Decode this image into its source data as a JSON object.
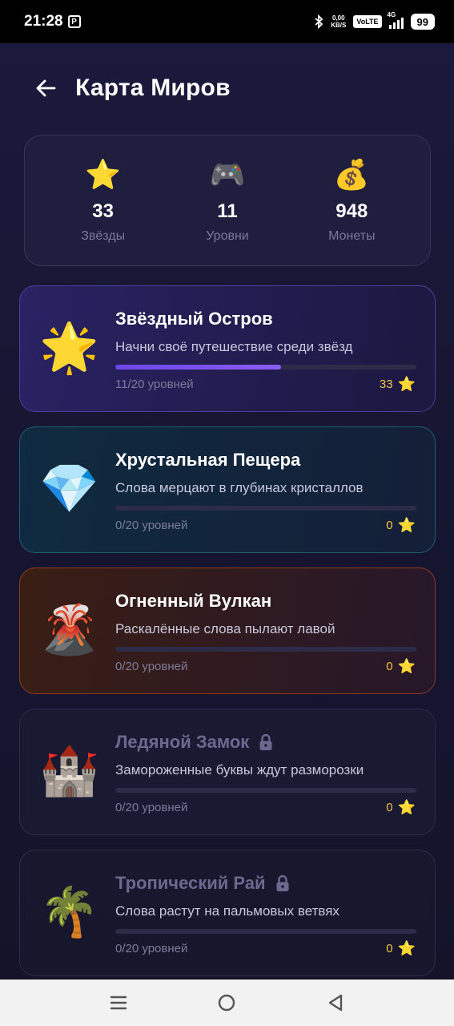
{
  "status_bar": {
    "time": "21:28",
    "net_speed_value": "0,00",
    "net_speed_unit": "KB/S",
    "volte": "VoLTE",
    "network": "4G",
    "battery": "99"
  },
  "header": {
    "title": "Карта Миров"
  },
  "stats": [
    {
      "icon": "⭐",
      "icon_name": "star-icon",
      "value": "33",
      "label": "Звёзды"
    },
    {
      "icon": "🎮",
      "icon_name": "gamepad-icon",
      "value": "11",
      "label": "Уровни"
    },
    {
      "icon": "💰",
      "icon_name": "money-bag-icon",
      "value": "948",
      "label": "Монеты"
    }
  ],
  "worlds": [
    {
      "icon": "🌟",
      "icon_name": "glowing-star-icon",
      "title": "Звёздный Остров",
      "description": "Начни своё путешествие среди звёзд",
      "levels_text": "11/20 уровней",
      "progress": 0.55,
      "stars": "33",
      "locked": false
    },
    {
      "icon": "💎",
      "icon_name": "gem-icon",
      "title": "Хрустальная Пещера",
      "description": "Слова мерцают в глубинах кристаллов",
      "levels_text": "0/20 уровней",
      "progress": 0,
      "stars": "0",
      "locked": false
    },
    {
      "icon": "🌋",
      "icon_name": "volcano-icon",
      "title": "Огненный Вулкан",
      "description": "Раскалённые слова пылают лавой",
      "levels_text": "0/20 уровней",
      "progress": 0,
      "stars": "0",
      "locked": false
    },
    {
      "icon": "🏰",
      "icon_name": "castle-icon",
      "title": "Ледяной Замок",
      "description": "Замороженные буквы ждут разморозки",
      "levels_text": "0/20 уровней",
      "progress": 0,
      "stars": "0",
      "locked": true
    },
    {
      "icon": "🌴",
      "icon_name": "palm-tree-icon",
      "title": "Тропический Рай",
      "description": "Слова растут на пальмовых ветвях",
      "levels_text": "0/20 уровней",
      "progress": 0,
      "stars": "0",
      "locked": true
    }
  ],
  "star_glyph": "⭐",
  "colors": {
    "background": "#171633",
    "accent_progress": "#7c4dff",
    "star_count": "#f5c542",
    "locked_title": "#6c6890"
  }
}
